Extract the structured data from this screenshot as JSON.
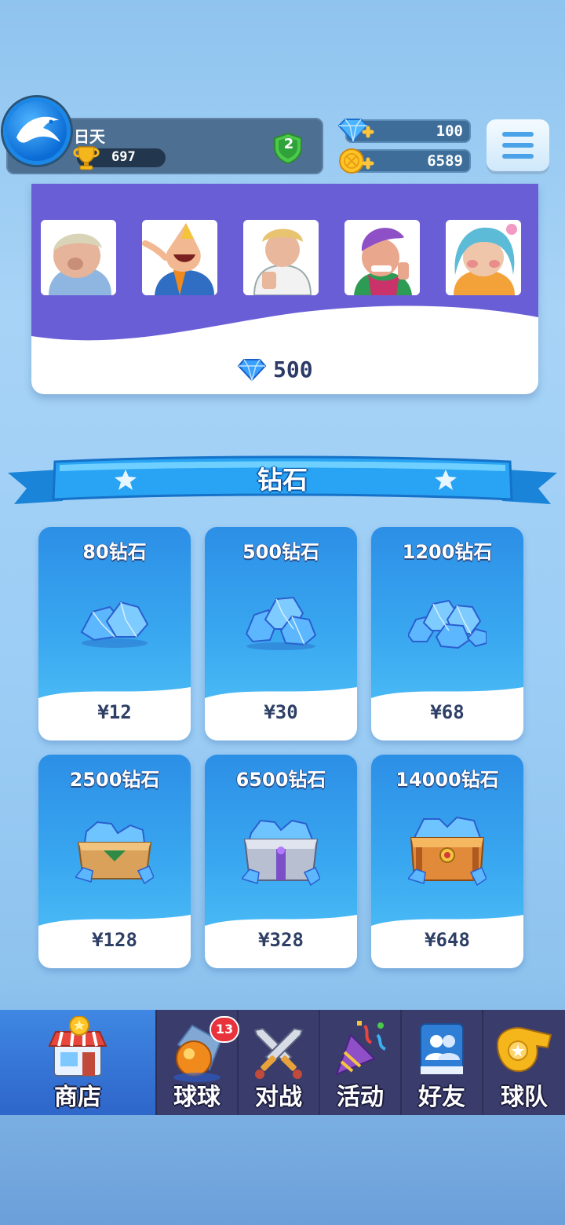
{
  "header": {
    "player_name": "日天",
    "trophies": "697",
    "level": "2",
    "diamonds": "100",
    "coins": "6589"
  },
  "sticker_pack": {
    "stickers": [
      "sticker-1",
      "sticker-2",
      "sticker-3",
      "sticker-4",
      "sticker-5"
    ],
    "price": "500"
  },
  "section": {
    "title": "钻石"
  },
  "products": [
    {
      "title": "80钻石",
      "price": "¥12"
    },
    {
      "title": "500钻石",
      "price": "¥30"
    },
    {
      "title": "1200钻石",
      "price": "¥68"
    },
    {
      "title": "2500钻石",
      "price": "¥128"
    },
    {
      "title": "6500钻石",
      "price": "¥328"
    },
    {
      "title": "14000钻石",
      "price": "¥648"
    }
  ],
  "nav": {
    "items": [
      {
        "label": "商店",
        "icon": "shop-icon"
      },
      {
        "label": "球球",
        "icon": "ball-icon",
        "badge": "13"
      },
      {
        "label": "对战",
        "icon": "swords-icon"
      },
      {
        "label": "活动",
        "icon": "party-icon"
      },
      {
        "label": "好友",
        "icon": "friends-icon"
      },
      {
        "label": "球队",
        "icon": "whistle-icon"
      }
    ]
  },
  "colors": {
    "accent": "#2c8fe6",
    "pack_purple": "#6a5ed6",
    "nav_bg": "#3a3c6c",
    "badge_red": "#e8323c"
  }
}
